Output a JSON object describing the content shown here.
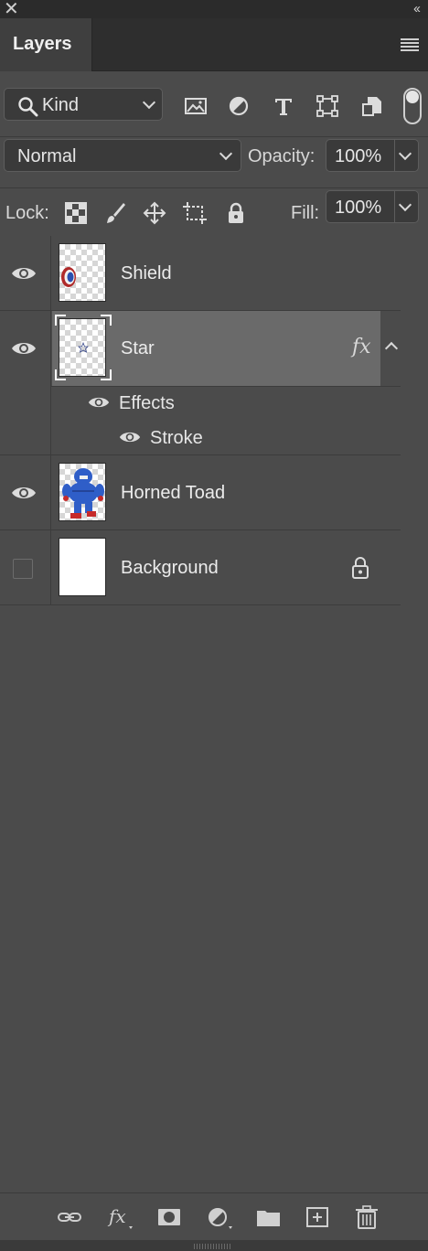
{
  "panel": {
    "tab_title": "Layers",
    "close_glyph": "✕",
    "collapse_glyph": "‹‹"
  },
  "filter": {
    "kind_label": "Kind",
    "icons": [
      "pixel-filter-icon",
      "adjustment-filter-icon",
      "type-filter-icon",
      "shape-filter-icon",
      "smart-object-filter-icon"
    ]
  },
  "blend": {
    "mode": "Normal",
    "opacity_label": "Opacity:",
    "opacity_value": "100%"
  },
  "lock": {
    "label": "Lock:",
    "fill_label": "Fill:",
    "fill_value": "100%"
  },
  "layers": [
    {
      "name": "Shield",
      "visible": true
    },
    {
      "name": "Star",
      "visible": true,
      "selected": true,
      "fx": "fx",
      "effects": {
        "label": "Effects",
        "items": [
          "Stroke"
        ]
      }
    },
    {
      "name": "Horned Toad",
      "visible": true
    },
    {
      "name": "Background",
      "visible": false,
      "locked": true
    }
  ],
  "colors": {
    "panel_bg": "#4b4b4b",
    "selected_bg": "#6a6a6a",
    "header_bg": "#2e2e2e"
  }
}
